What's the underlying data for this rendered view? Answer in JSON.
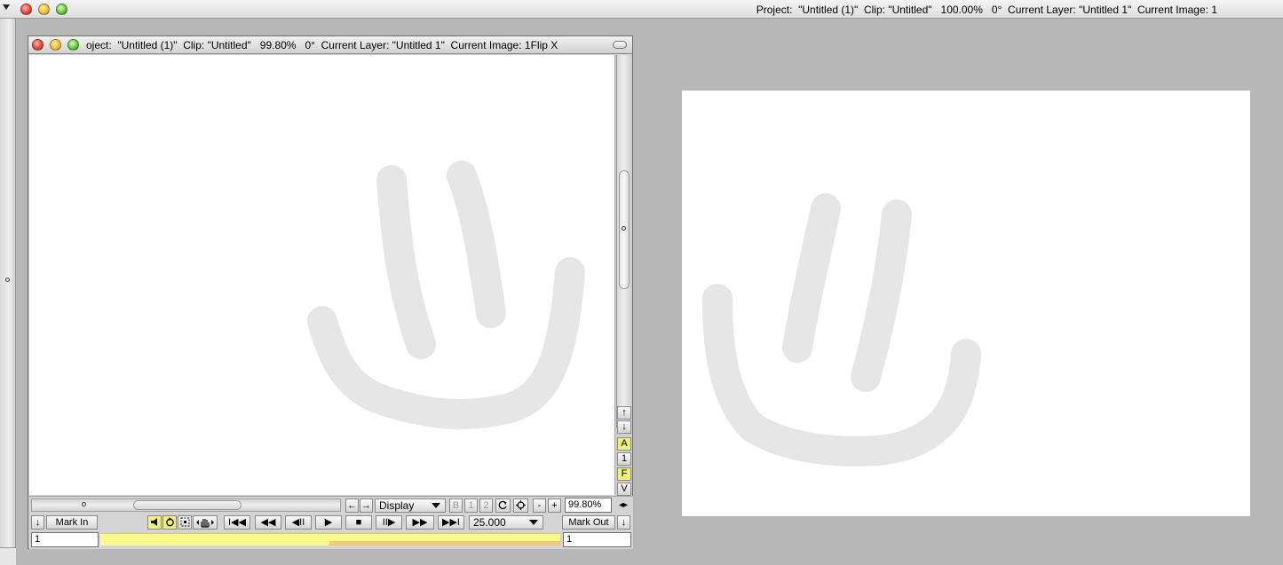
{
  "topbar": {
    "status": "Project:  \"Untitled (1)\"  Clip: \"Untitled\"   100.00%   0°  Current Layer: \"Untitled 1\"  Current Image: 1"
  },
  "window": {
    "title": "oject:  \"Untitled (1)\"  Clip: \"Untitled\"   99.80%   0°  Current Layer: \"Untitled 1\"  Current Image: 1Flip X"
  },
  "side_buttons": {
    "up": "↑",
    "down": "↓",
    "a": "A",
    "one": "1",
    "f": "F",
    "v": "V"
  },
  "toolbar": {
    "nav_left": "←",
    "nav_right": "→",
    "display_select": "Display",
    "btn_b": "B",
    "btn_1": "1",
    "btn_2": "2",
    "minus": "-",
    "plus": "+",
    "zoom_value": "99.80%",
    "zoom_arrows": "◂▸"
  },
  "transport": {
    "down_left": "↓",
    "mark_in": "Mark In",
    "first": "I◀◀",
    "rewind": "◀◀",
    "step_back": "◀II",
    "play": "▶",
    "stop": "■",
    "step_fwd": "II▶",
    "ffwd": "▶▶",
    "last": "▶▶I",
    "fps": "25.000",
    "mark_out": "Mark Out",
    "down_right": "↓"
  },
  "frames": {
    "in_value": "1",
    "out_value": "1"
  },
  "colors": {
    "background": "#b7b7b7",
    "stroke": "#e6e6e6",
    "timeline": "#fbfb8c",
    "toggle_active": "#f3f07a"
  },
  "icons": {
    "close": "close-icon",
    "minimize": "minimize-icon",
    "zoom": "zoom-icon",
    "speaker": "speaker-icon",
    "loop": "loop-icon",
    "select": "select-icon",
    "hand": "hand-icon",
    "rotate": "rotate-icon",
    "center": "center-icon"
  }
}
